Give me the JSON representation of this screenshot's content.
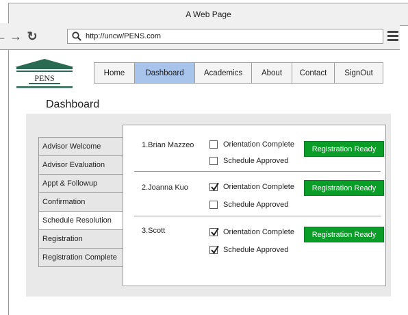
{
  "window": {
    "title": "A Web Page"
  },
  "browser": {
    "url": "http://uncw/PENS.com"
  },
  "logo": {
    "text": "PENS"
  },
  "nav": {
    "tabs": [
      {
        "label": "Home"
      },
      {
        "label": "Dashboard"
      },
      {
        "label": "Academics"
      },
      {
        "label": "About"
      },
      {
        "label": "Contact"
      },
      {
        "label": "SignOut"
      }
    ],
    "active": "Dashboard"
  },
  "page": {
    "title": "Dashboard"
  },
  "sidebar": {
    "items": [
      {
        "label": "Advisor Welcome"
      },
      {
        "label": "Advisor Evaluation"
      },
      {
        "label": "Appt & Followup"
      },
      {
        "label": "Confirmation"
      },
      {
        "label": "Schedule Resolution"
      },
      {
        "label": "Registration"
      },
      {
        "label": "Registration Complete"
      }
    ],
    "active": "Schedule Resolution"
  },
  "students": [
    {
      "name": "1.Brian Mazzeo",
      "orientation_label": "Orientation Complete",
      "orientation_checked": false,
      "schedule_label": "Schedule Approved",
      "schedule_checked": false,
      "button_label": "Registration Ready"
    },
    {
      "name": "2.Joanna Kuo",
      "orientation_label": "Orientation Complete",
      "orientation_checked": true,
      "schedule_label": "Schedule Approved",
      "schedule_checked": false,
      "button_label": "Registration Ready"
    },
    {
      "name": "3.Scott",
      "orientation_label": "Orientation Complete",
      "orientation_checked": true,
      "schedule_label": "Schedule Approved",
      "schedule_checked": true,
      "button_label": "Registration Ready"
    }
  ],
  "colors": {
    "active_tab": "#a9c4eb",
    "button_green": "#0a9e29"
  }
}
